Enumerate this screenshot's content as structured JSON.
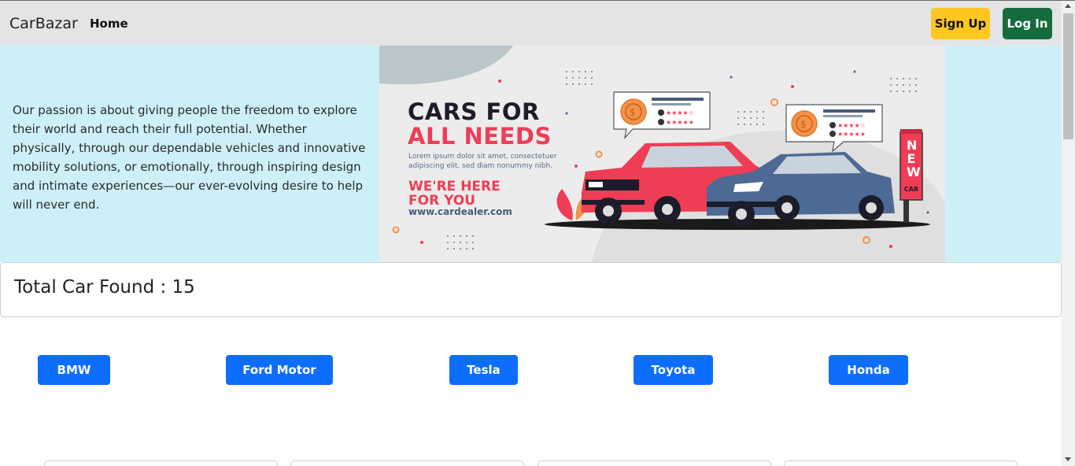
{
  "navbar": {
    "brand": "CarBazar",
    "home_link": "Home",
    "signup_label": "Sign Up",
    "login_label": "Log In"
  },
  "hero": {
    "description": "Our passion is about giving people the freedom to explore their world and reach their full potential. Whether physically, through our dependable vehicles and innovative mobility solutions, or emotionally, through inspiring design and intimate experiences—our ever-evolving desire to help will never end.",
    "banner": {
      "headline_1": "CARS FOR",
      "headline_2": "ALL NEEDS",
      "lorem": "Lorem ipsum dolor sit amet, consectetuer adipiscing elit, sed diam nonummy nibh.",
      "tagline": "WE'RE HERE FOR YOU",
      "url": "www.cardealer.com",
      "sign_text_1": "NEW",
      "sign_text_2": "CAR"
    }
  },
  "total": {
    "label": "Total Car Found : 15"
  },
  "brands": [
    {
      "label": "BMW"
    },
    {
      "label": "Ford Motor"
    },
    {
      "label": "Tesla"
    },
    {
      "label": "Toyota"
    },
    {
      "label": "Honda"
    }
  ],
  "colors": {
    "navbar_bg": "#e3e4e6",
    "hero_bg": "#cdf0f8",
    "signup_bg": "#ffc720",
    "login_bg": "#166c3c",
    "brand_button_bg": "#0d6efd",
    "banner_accent": "#ef3d55"
  }
}
